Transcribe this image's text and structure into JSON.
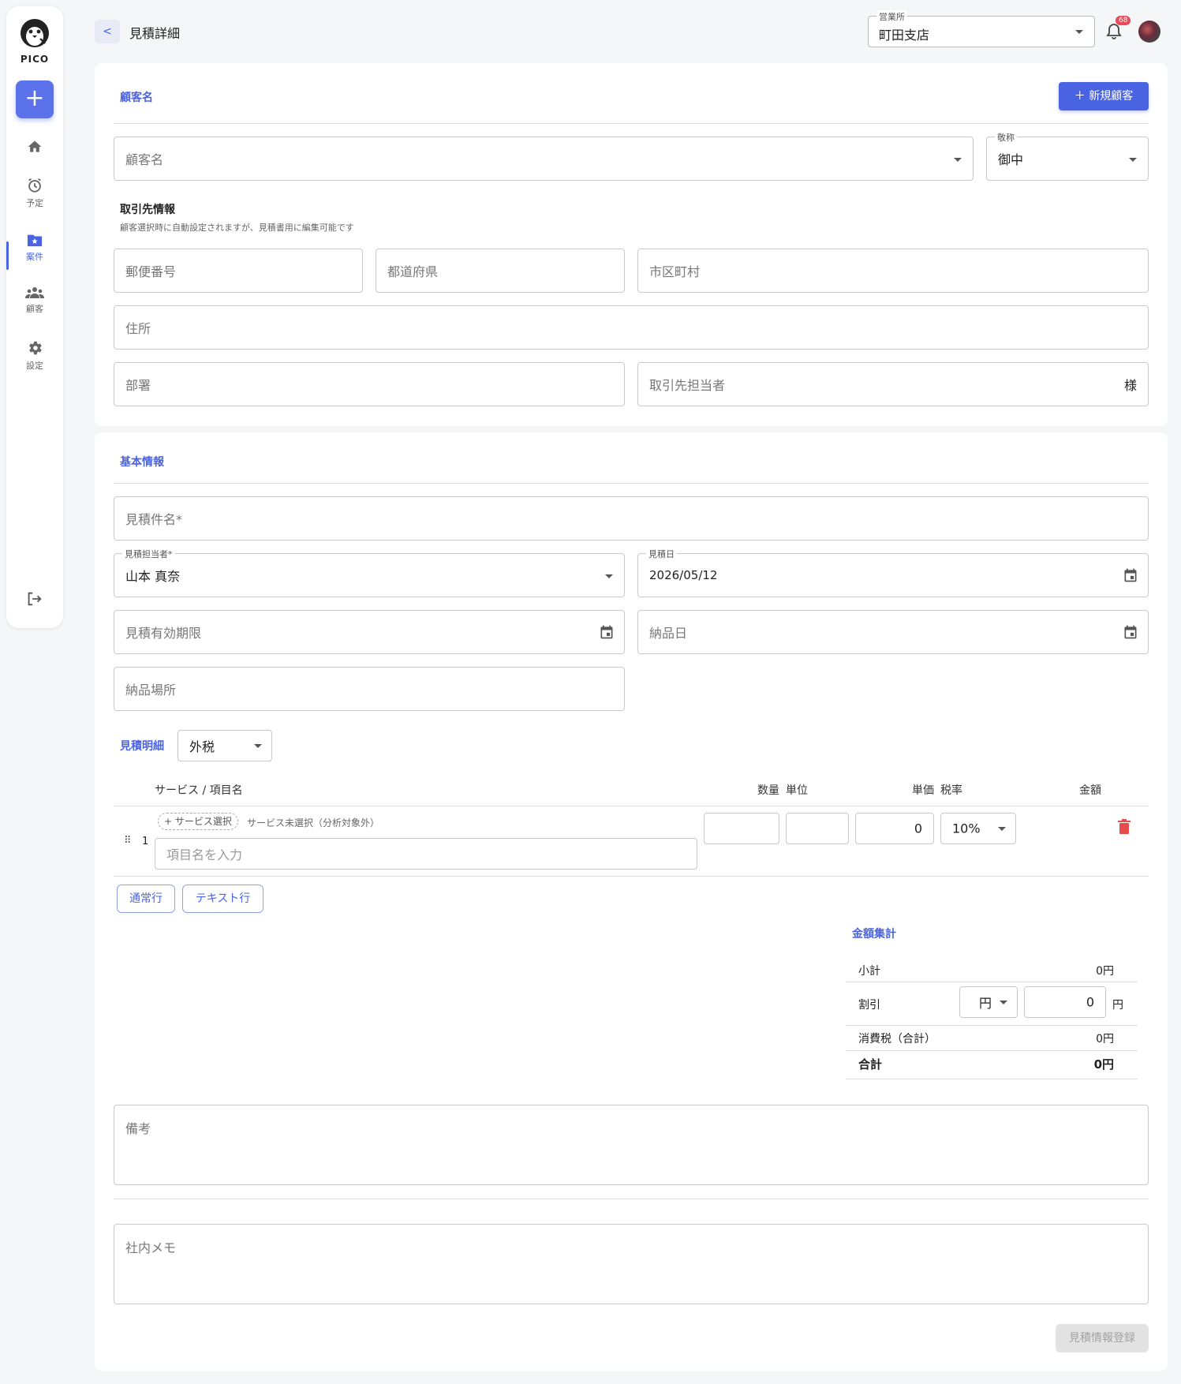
{
  "sidebar": {
    "logo_text": "PICO",
    "add_label": "+",
    "items": [
      {
        "label": ""
      },
      {
        "label": "予定"
      },
      {
        "label": "案件"
      },
      {
        "label": "顧客"
      },
      {
        "label": "設定"
      }
    ],
    "active_item": "案件"
  },
  "header": {
    "back_label": "<",
    "title": "見積詳細",
    "office_label": "営業所",
    "office_value": "町田支店",
    "notification_count": "68"
  },
  "customer": {
    "section_title": "顧客名",
    "new_customer_button": "新規顧客",
    "customer_name_placeholder": "顧客名",
    "honorific_label": "敬称",
    "honorific_value": "御中",
    "partner_info_title": "取引先情報",
    "partner_info_desc": "顧客選択時に自動設定されますが、見積書用に編集可能です",
    "postal_placeholder": "郵便番号",
    "prefecture_placeholder": "都道府県",
    "city_placeholder": "市区町村",
    "address_placeholder": "住所",
    "department_placeholder": "部署",
    "contact_placeholder": "取引先担当者",
    "contact_suffix": "様"
  },
  "basic": {
    "section_title": "基本情報",
    "estimate_name_placeholder": "見積件名",
    "required_mark": "*",
    "staff_label": "見積担当者",
    "staff_value": "山本 真奈",
    "date_label": "見積日",
    "date_value": "2026/05/12",
    "expiry_placeholder": "見積有効期限",
    "delivery_date_placeholder": "納品日",
    "delivery_place_placeholder": "納品場所"
  },
  "details": {
    "title": "見積明細",
    "tax_mode": "外税",
    "columns": {
      "service": "サービス / 項目名",
      "quantity": "数量",
      "unit": "単位",
      "unit_price": "単価",
      "tax_rate": "税率",
      "amount": "金額"
    },
    "rows": [
      {
        "no": "1",
        "service_button": "+ サービス選択",
        "service_note": "サービス未選択（分析対象外）",
        "item_placeholder": "項目名を入力",
        "quantity": "",
        "unit": "",
        "unit_price": "0",
        "tax_rate": "10%"
      }
    ],
    "add_normal_row": "通常行",
    "add_text_row": "テキスト行"
  },
  "summary": {
    "title": "金額集計",
    "subtotal_label": "小計",
    "subtotal_value": "0円",
    "discount_label": "割引",
    "discount_unit_select": "円",
    "discount_value": "0",
    "discount_suffix": "円",
    "tax_label": "消費税（合計）",
    "tax_value": "0円",
    "total_label": "合計",
    "total_value": "0円"
  },
  "notes": {
    "remarks_placeholder": "備考",
    "internal_memo_placeholder": "社内メモ"
  },
  "submit_label": "見積情報登録",
  "colors": {
    "accent": "#4a63e3",
    "danger": "#e54b4b",
    "disabled_bg": "#e2e2e2"
  }
}
